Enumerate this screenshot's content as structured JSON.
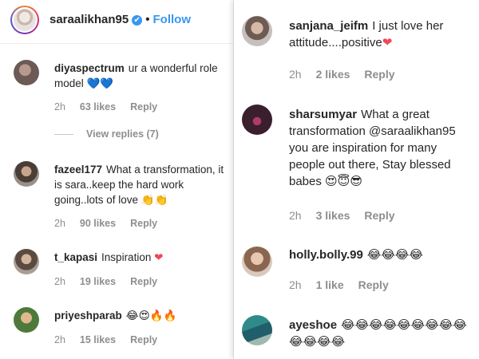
{
  "header": {
    "username": "saraalikhan95",
    "verified_mark": "✔",
    "separator": "•",
    "follow_label": "Follow"
  },
  "left_comments": [
    {
      "user": "diyaspectrum",
      "text": "ur a wonderful role model",
      "emoji": "💙💙",
      "time": "2h",
      "likes": "63 likes",
      "reply": "Reply"
    },
    {
      "user": "fazeel177",
      "text": "What a transformation, it is sara..keep the hard work going..lots of love",
      "emoji": "👏👏",
      "time": "2h",
      "likes": "90 likes",
      "reply": "Reply"
    },
    {
      "user": "t_kapasi",
      "text": "Inspiration",
      "emoji": "❤",
      "time": "2h",
      "likes": "19 likes",
      "reply": "Reply"
    },
    {
      "user": "priyeshparab",
      "text": "",
      "emoji": "😂😍🔥🔥",
      "time": "2h",
      "likes": "15 likes",
      "reply": "Reply"
    }
  ],
  "view_replies": "View replies (7)",
  "right_comments": [
    {
      "user": "sanjana_jeifm",
      "text": "I just love her attitude....positive",
      "emoji": "❤",
      "time": "2h",
      "likes": "2 likes",
      "reply": "Reply"
    },
    {
      "user": "sharsumyar",
      "text": "What a great transformation @saraalikhan95 you are inspiration for many people out there, Stay blessed babes",
      "emoji": "😍😇😎",
      "time": "2h",
      "likes": "3 likes",
      "reply": "Reply"
    },
    {
      "user": "holly.bolly.99",
      "text": "",
      "emoji": "😂😂😂😂",
      "time": "2h",
      "likes": "1 like",
      "reply": "Reply"
    },
    {
      "user": "ayeshoe",
      "text": "",
      "emoji": "😂😂😂😂😂😂😂😂😂😂😂😂😂",
      "time": "",
      "likes": "",
      "reply": ""
    }
  ],
  "icons": {
    "heart": "heart-icon",
    "verified": "verified-badge-icon"
  },
  "colors": {
    "link": "#3897f0",
    "muted": "#8e8e8e",
    "text": "#262626",
    "heart": "#ed4956"
  }
}
